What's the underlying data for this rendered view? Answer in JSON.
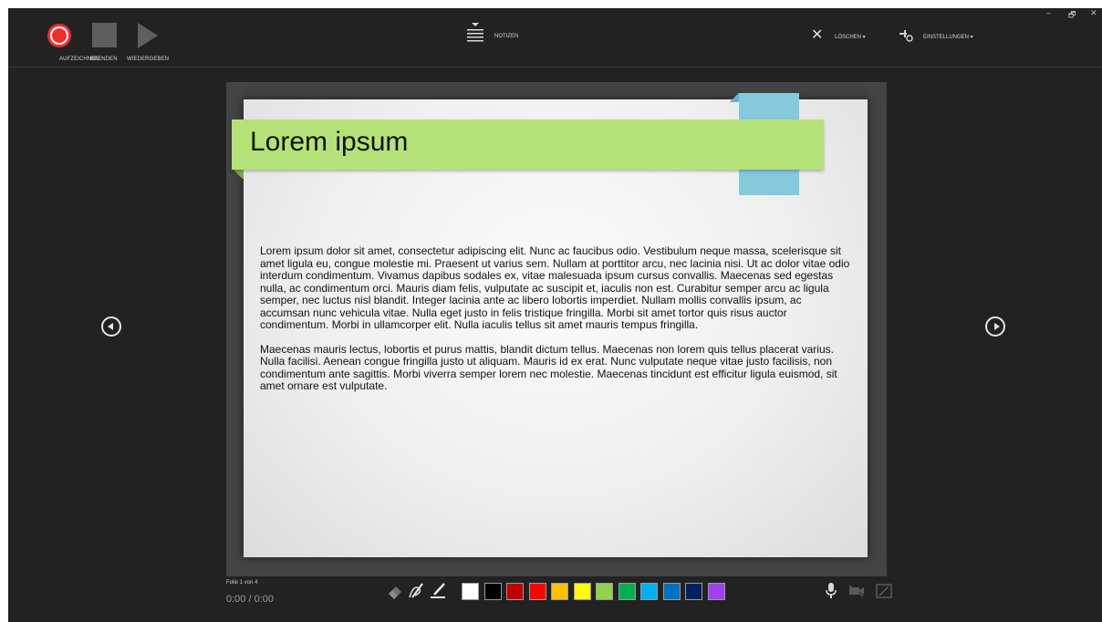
{
  "toolbar": {
    "record_label": "AUFZEICHNEN",
    "stop_label": "BEENDEN",
    "play_label": "WIEDERGEBEN",
    "notes_label": "NOTIZEN",
    "delete_label": "LÖSCHEN ▾",
    "settings_label": "EINSTELLUNGEN ▾",
    "icons": [
      "record-icon",
      "stop-icon",
      "play-icon",
      "notes-icon",
      "close-x-icon",
      "settings-icon"
    ]
  },
  "window": {
    "minimize": "–",
    "restore": "🗗",
    "close": "✕"
  },
  "slide": {
    "title": "Lorem ipsum",
    "paragraphs": [
      "Lorem ipsum dolor sit amet, consectetur adipiscing elit. Nunc ac faucibus odio. Vestibulum neque massa, scelerisque sit amet ligula eu, congue molestie mi. Praesent ut varius sem. Nullam at porttitor arcu, nec lacinia nisi. Ut ac dolor vitae odio interdum condimentum. Vivamus dapibus sodales ex, vitae malesuada ipsum cursus convallis. Maecenas sed egestas nulla, ac condimentum orci. Mauris diam felis, vulputate ac suscipit et, iaculis non est. Curabitur semper arcu ac ligula semper, nec luctus nisl blandit. Integer lacinia ante ac libero lobortis imperdiet. Nullam mollis convallis ipsum, ac accumsan nunc vehicula vitae. Nulla eget justo in felis tristique fringilla. Morbi sit amet tortor quis risus auctor condimentum. Morbi in ullamcorper elit. Nulla iaculis tellus sit amet mauris tempus fringilla.",
      "Maecenas mauris lectus, lobortis et purus mattis, blandit dictum tellus. Maecenas non lorem quis tellus placerat varius. Nulla facilisi. Aenean congue fringilla justo ut aliquam. Mauris id ex erat. Nunc vulputate neque vitae justo facilisis, non condimentum ante sagittis. Morbi viverra semper lorem nec molestie. Maecenas tincidunt est efficitur ligula euismod, sit amet ornare est vulputate."
    ],
    "title_band_color": "#b4e279",
    "tag_color": "#86c9df"
  },
  "navigation": {
    "prev_icon": "arrow-left-circle-icon",
    "next_icon": "arrow-right-circle-icon"
  },
  "status": {
    "slide_counter": "Folie 1 von 4",
    "timer": "0:00 / 0:00"
  },
  "pen_tools": [
    "eraser-icon",
    "pen-icon",
    "highlighter-icon"
  ],
  "pen_colors": [
    "#ffffff",
    "#000000",
    "#c00000",
    "#ff0000",
    "#ffc000",
    "#ffff00",
    "#92d050",
    "#00b050",
    "#00b0f0",
    "#0070c0",
    "#002060",
    "#a040f0"
  ],
  "media_tools": [
    "microphone-icon",
    "camera-icon",
    "camera-preview-icon"
  ]
}
